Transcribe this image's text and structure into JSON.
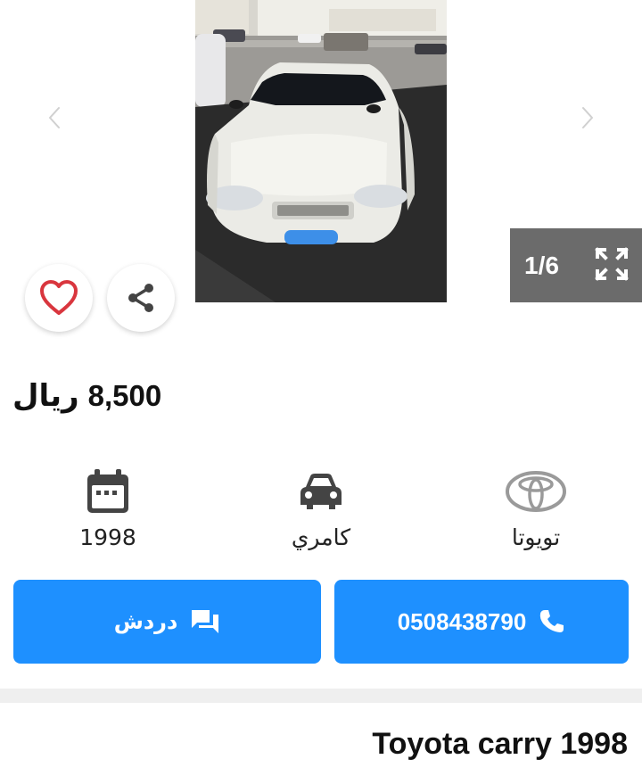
{
  "gallery": {
    "counter": "1/6",
    "current": 1,
    "total": 6
  },
  "price": {
    "value": "8,500",
    "currency": "ريال"
  },
  "specs": {
    "year": "1998",
    "model": "كامري",
    "brand": "تويوتا"
  },
  "actions": {
    "chat_label": "دردش",
    "phone_label": "0508438790"
  },
  "listing": {
    "title": "Toyota carry 1998"
  },
  "colors": {
    "accent": "#1e90ff",
    "favorite": "#d9363e",
    "counter_bg": "#6b6b6b",
    "icon_gray": "#444444"
  }
}
